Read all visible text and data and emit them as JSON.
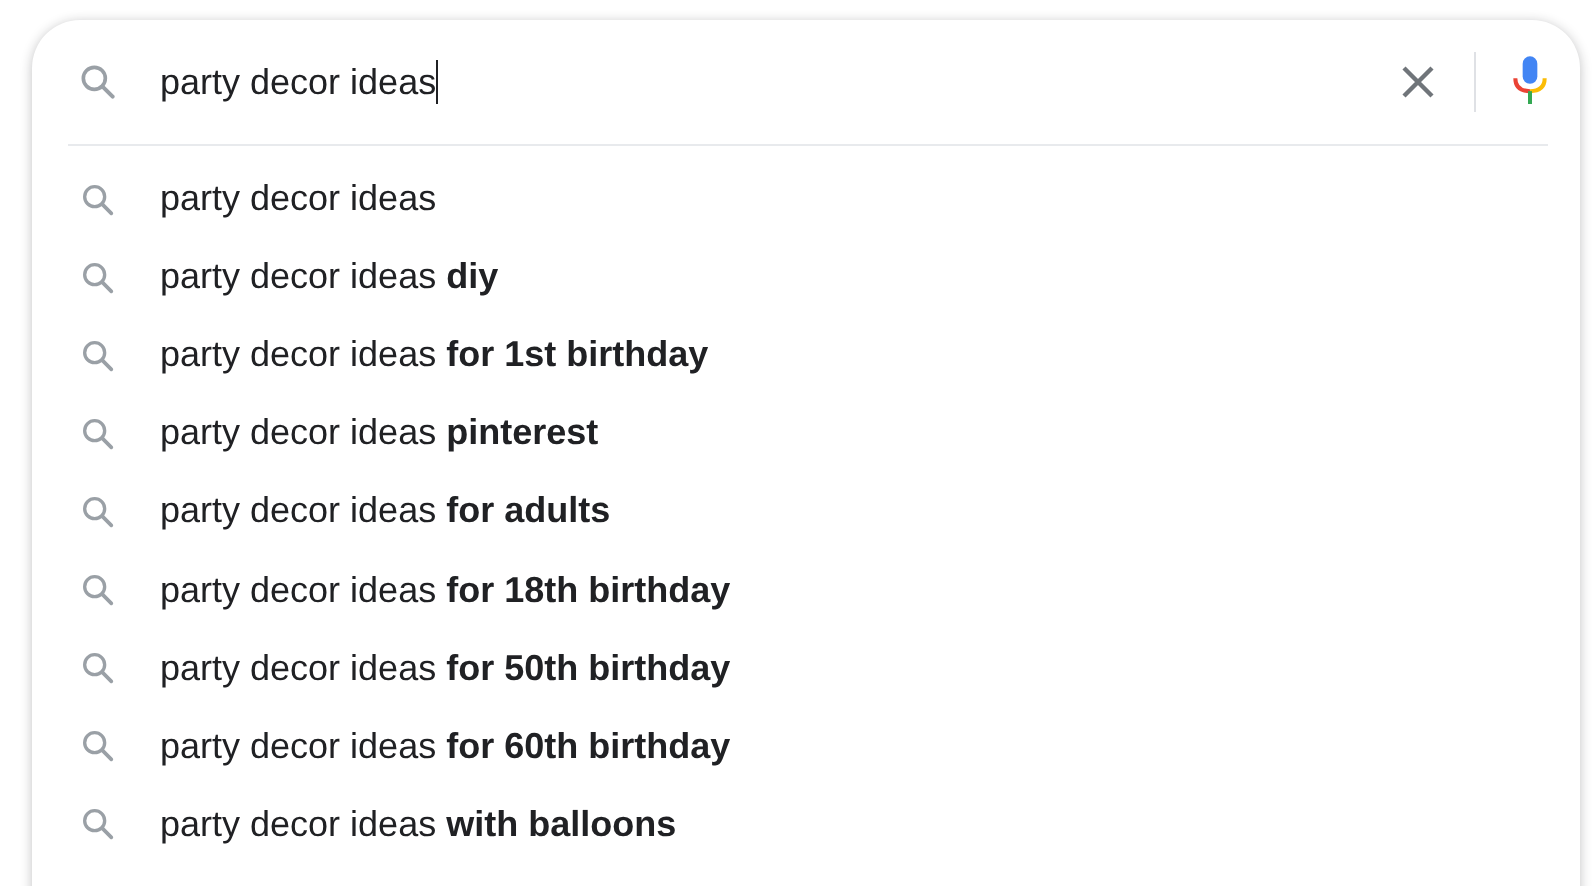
{
  "search": {
    "value": "party decor ideas"
  },
  "suggestions": [
    {
      "text": "party decor ideas"
    },
    {
      "text": "party decor ideas **diy**"
    },
    {
      "text": "party decor ideas **for 1st birthday**"
    },
    {
      "text": "party decor ideas **pinterest**"
    },
    {
      "text": "party decor ideas **for adults**"
    },
    {
      "text": "party decor ideas **for 18th birthday**"
    },
    {
      "text": "party decor ideas **for 50th birthday**"
    },
    {
      "text": "party decor ideas **for 60th birthday**"
    },
    {
      "text": "party decor ideas **with balloons**"
    }
  ]
}
